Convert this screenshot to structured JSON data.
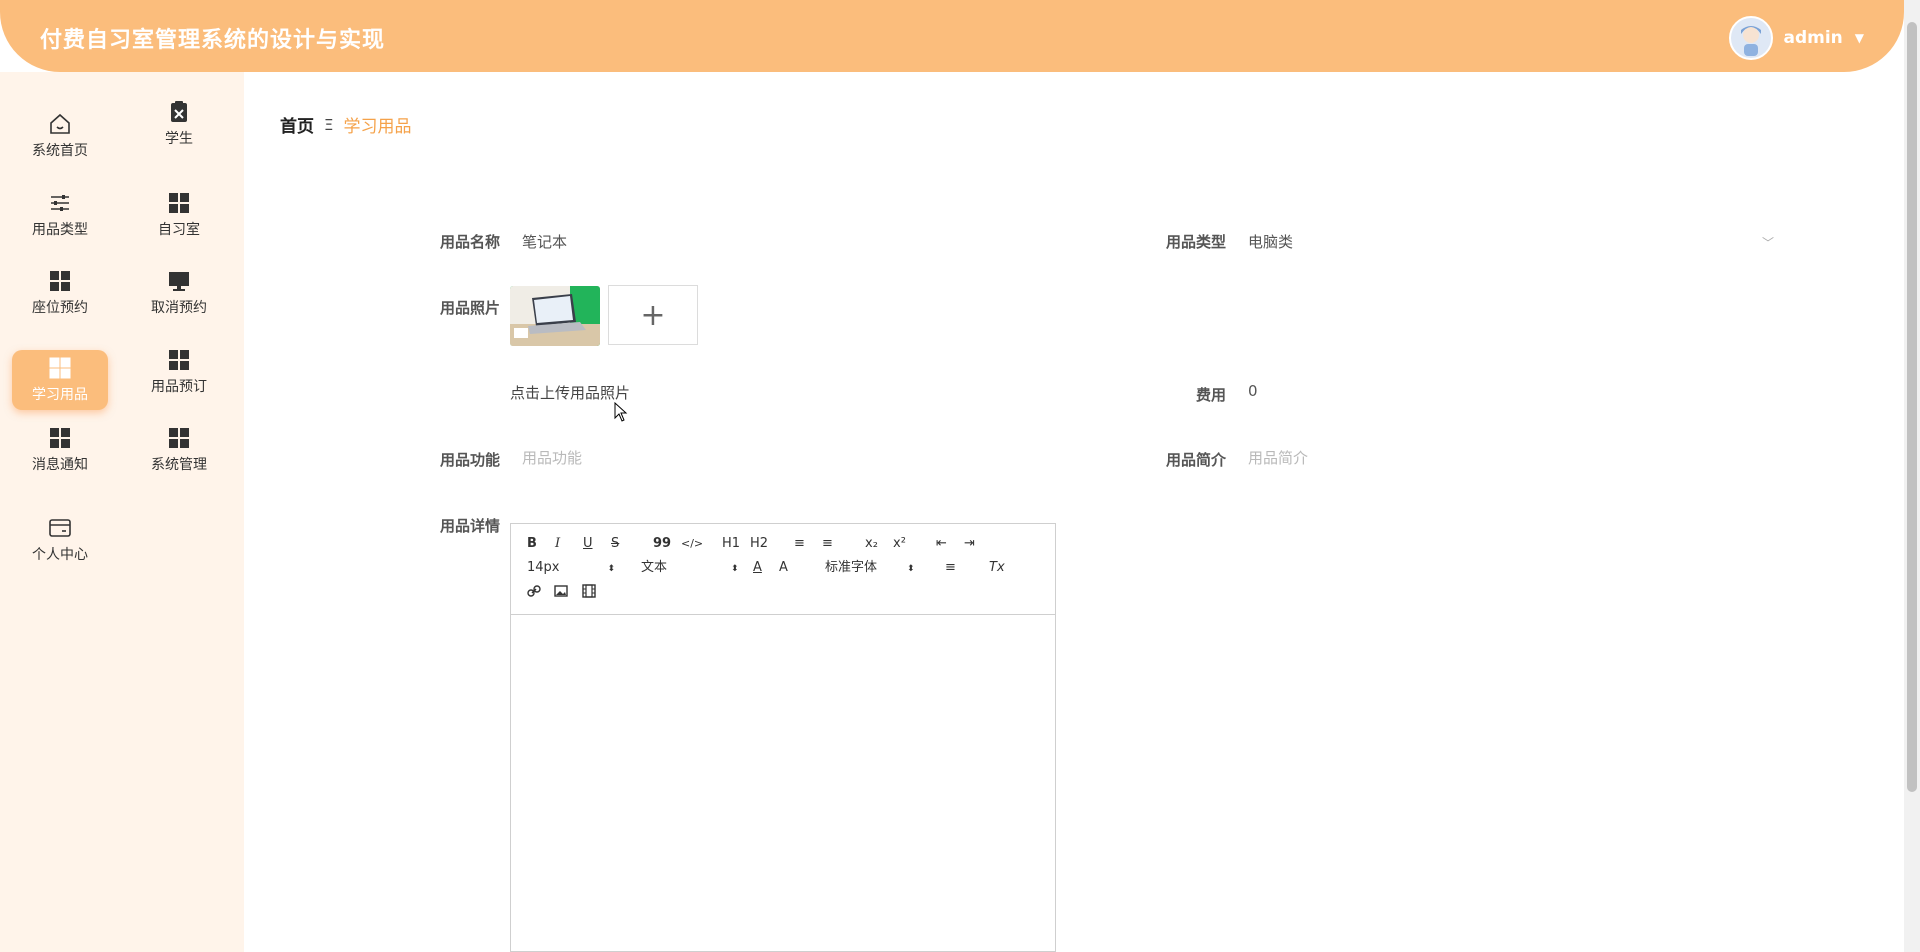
{
  "app_title": "付费自习室管理系统的设计与实现",
  "user": {
    "name": "admin"
  },
  "sidebar": {
    "items": [
      {
        "label": "系统首页",
        "icon": "home-icon"
      },
      {
        "label": "学生",
        "icon": "clipboard-x-icon"
      },
      {
        "label": "用品类型",
        "icon": "sliders-icon"
      },
      {
        "label": "自习室",
        "icon": "grid-icon"
      },
      {
        "label": "座位预约",
        "icon": "grid-icon"
      },
      {
        "label": "取消预约",
        "icon": "monitor-icon"
      },
      {
        "label": "学习用品",
        "icon": "grid-icon",
        "active": true
      },
      {
        "label": "用品预订",
        "icon": "grid-icon"
      },
      {
        "label": "消息通知",
        "icon": "grid-icon"
      },
      {
        "label": "系统管理",
        "icon": "grid-icon"
      },
      {
        "label": "个人中心",
        "icon": "card-icon"
      }
    ]
  },
  "breadcrumb": {
    "home": "首页",
    "separator": "Ξ",
    "current": "学习用品"
  },
  "form": {
    "name_label": "用品名称",
    "name_value": "笔记本",
    "type_label": "用品类型",
    "type_value": "电脑类",
    "photo_label": "用品照片",
    "upload_hint": "点击上传用品照片",
    "fee_label": "费用",
    "fee_value": "0",
    "function_label": "用品功能",
    "function_placeholder": "用品功能",
    "intro_label": "用品简介",
    "intro_placeholder": "用品简介",
    "detail_label": "用品详情"
  },
  "editor": {
    "font_size": "14px",
    "text_style": "文本",
    "font_family": "标准字体",
    "buttons": {
      "bold": "B",
      "italic": "I",
      "underline": "U",
      "strike": "S",
      "quote": "99",
      "code": "</>",
      "h1": "H1",
      "h2": "H2",
      "ol": "≡",
      "ul": "≡",
      "sub": "x₂",
      "sup": "x²",
      "color": "A",
      "bg": "A",
      "align": "≡",
      "clean": "Tx"
    }
  },
  "colors": {
    "accent": "#fbbd7c",
    "accent_text": "#f5a24a",
    "sidebar_bg": "#fff4ea"
  }
}
